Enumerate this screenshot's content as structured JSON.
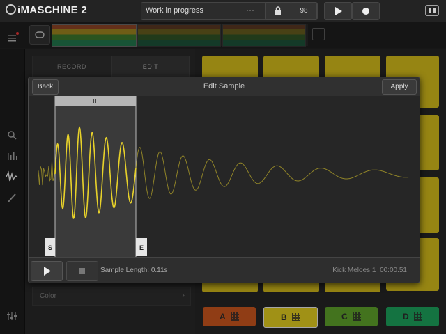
{
  "app": {
    "logo_text": "iMASCHINE 2"
  },
  "topbar": {
    "project_name": "Work in progress",
    "more_label": "···",
    "tempo": "98"
  },
  "left_panel": {
    "tab_record": "RECORD",
    "tab_edit": "EDIT",
    "color_label": "Color",
    "color_chevron": "›"
  },
  "groups": [
    {
      "label": "A",
      "color": "#c0521d"
    },
    {
      "label": "B",
      "color": "#d6c21e"
    },
    {
      "label": "C",
      "color": "#5a9a28"
    },
    {
      "label": "D",
      "color": "#1b9a57"
    }
  ],
  "pad_color": "#c9b21a",
  "modal": {
    "title": "Edit Sample",
    "back_label": "Back",
    "apply_label": "Apply",
    "start_marker": "S",
    "end_marker": "E",
    "sample_length": "Sample Length: 0.11s",
    "sample_name": "Kick Meloes 1",
    "sample_duration": "00:00.51",
    "waveform_color": "#e8d22a"
  },
  "sidebar": {
    "icons": [
      "menu-icon",
      "search-icon",
      "mixer-icon",
      "waveform-icon",
      "pencil-icon",
      "settings-icon"
    ]
  }
}
